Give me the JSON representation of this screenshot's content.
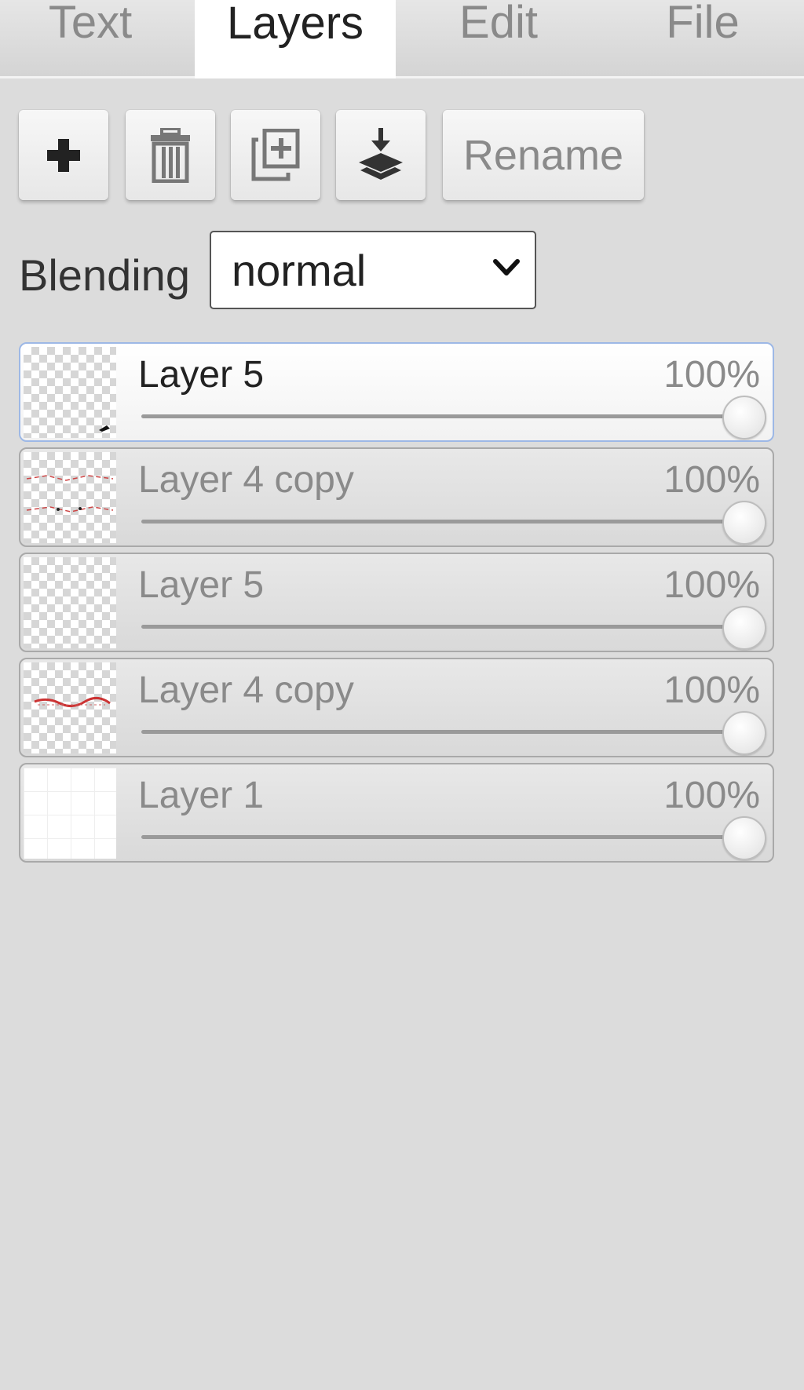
{
  "tabs": [
    {
      "label": "Text",
      "active": false
    },
    {
      "label": "Layers",
      "active": true
    },
    {
      "label": "Edit",
      "active": false
    },
    {
      "label": "File",
      "active": false
    }
  ],
  "toolbar": {
    "add_icon": "plus-icon",
    "delete_icon": "trash-icon",
    "duplicate_icon": "duplicate-icon",
    "merge_icon": "merge-down-icon",
    "rename_label": "Rename"
  },
  "blending": {
    "label": "Blending",
    "value": "normal"
  },
  "layers": [
    {
      "name": "Layer 5",
      "opacity": "100%",
      "opacity_value": 100,
      "selected": true
    },
    {
      "name": "Layer 4 copy",
      "opacity": "100%",
      "opacity_value": 100,
      "selected": false
    },
    {
      "name": "Layer 5",
      "opacity": "100%",
      "opacity_value": 100,
      "selected": false
    },
    {
      "name": "Layer 4 copy",
      "opacity": "100%",
      "opacity_value": 100,
      "selected": false
    },
    {
      "name": "Layer 1",
      "opacity": "100%",
      "opacity_value": 100,
      "selected": false
    }
  ],
  "colors": {
    "selected_border": "#9db8e6",
    "panel_background": "#dcdcdc"
  }
}
